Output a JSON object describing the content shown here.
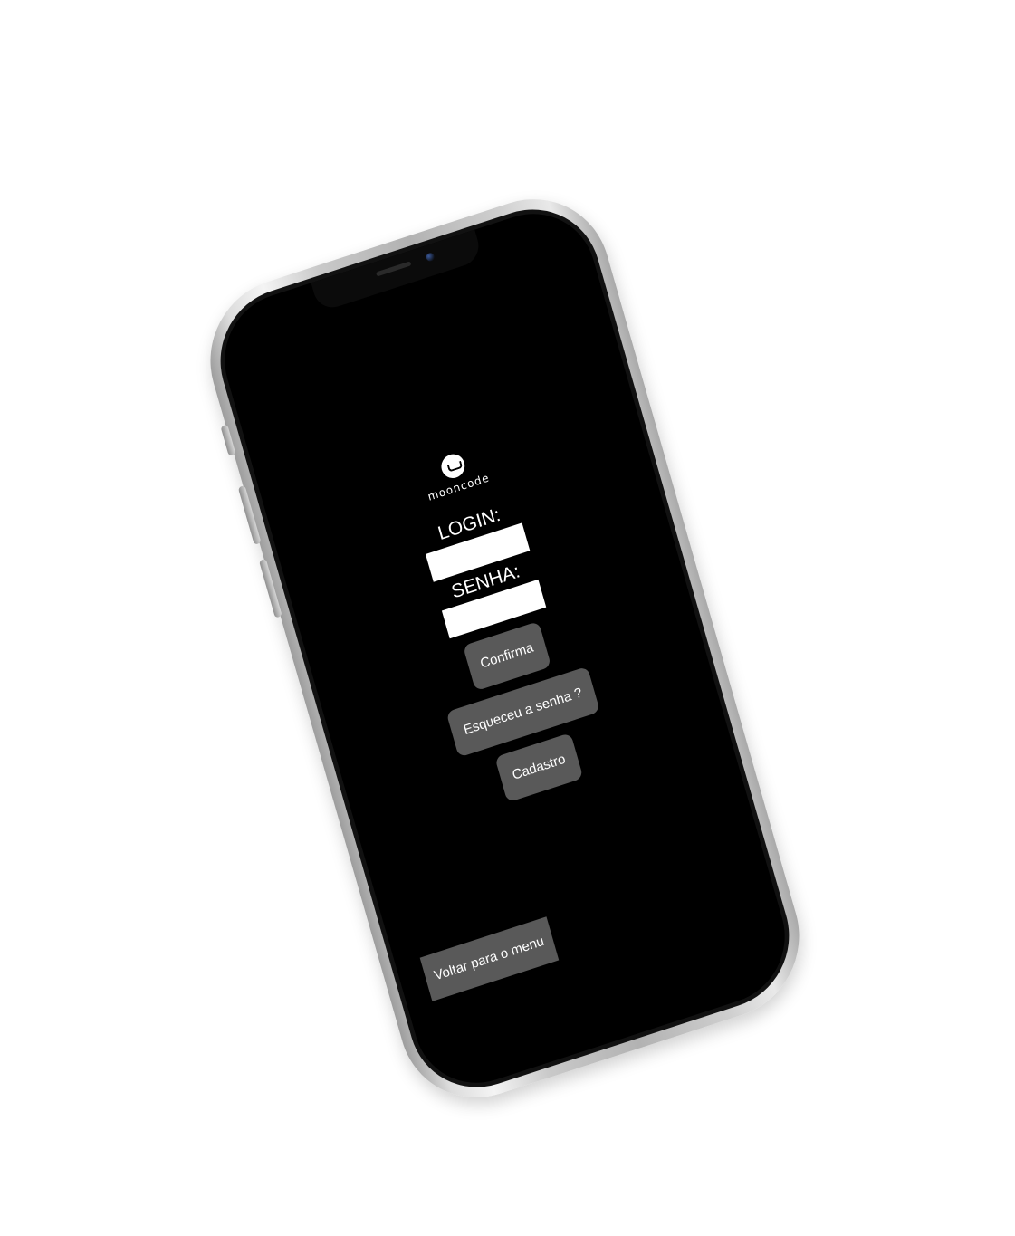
{
  "logo": {
    "text": "mooncode"
  },
  "login": {
    "label": "LOGIN:",
    "value": "",
    "placeholder": ""
  },
  "password": {
    "label": "SENHA:",
    "value": "",
    "placeholder": ""
  },
  "buttons": {
    "confirm": "Confirma",
    "forgot": "Esqueceu a senha ?",
    "register": "Cadastro",
    "back": "Voltar para o menu"
  },
  "colors": {
    "screen_bg": "#000000",
    "button_bg": "#595959",
    "text": "#ffffff"
  }
}
